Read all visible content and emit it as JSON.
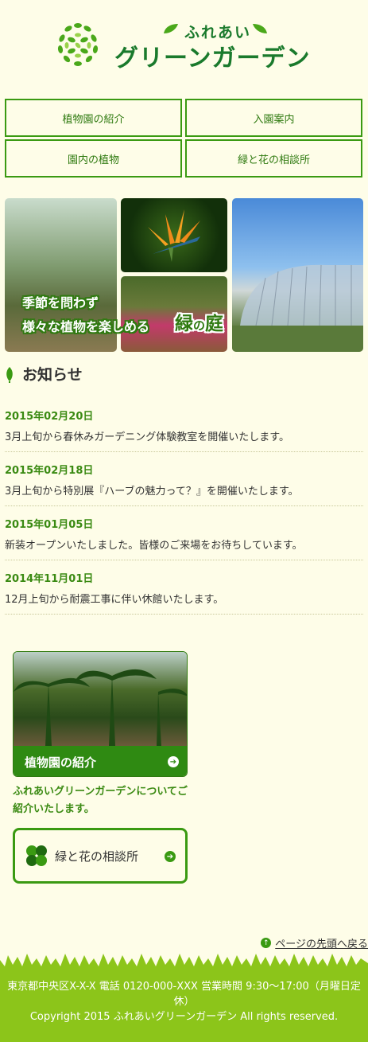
{
  "header": {
    "logo_sub": "ふれあい",
    "logo_main": "グリーンガーデン"
  },
  "nav": {
    "items": [
      {
        "label": "植物園の紹介"
      },
      {
        "label": "入園案内"
      },
      {
        "label": "園内の植物"
      },
      {
        "label": "緑と花の相談所"
      }
    ]
  },
  "hero": {
    "line1": "季節を問わず",
    "line2": "様々な植物を楽しめる",
    "big_a": "緑",
    "big_b": "の",
    "big_c": "庭"
  },
  "news": {
    "title": "お知らせ",
    "items": [
      {
        "date": "2015年02月20日",
        "text": "3月上旬から春休みガーデニング体験教室を開催いたします。"
      },
      {
        "date": "2015年02月18日",
        "text": "3月上旬から特別展『ハーブの魅力って？』を開催いたします。"
      },
      {
        "date": "2015年01月05日",
        "text": "新装オープンいたしました。皆様のご来場をお待ちしています。"
      },
      {
        "date": "2014年11月01日",
        "text": "12月上旬から耐震工事に伴い休館いたします。"
      }
    ]
  },
  "intro_card": {
    "label": "植物園の紹介",
    "desc": "ふれあいグリーンガーデンについてご紹介いたします。"
  },
  "consult": {
    "label": "緑と花の相談所"
  },
  "pagetop": {
    "label": "ページの先頭へ戻る"
  },
  "footer": {
    "address": "東京都中央区X-X-X 電話 0120-000-XXX 営業時間 9:30～17:00（月曜日定休）",
    "copyright": "Copyright 2015 ふれあいグリーンガーデン All rights reserved."
  },
  "colors": {
    "brand_green": "#2f7a10",
    "accent_green": "#3a9a12",
    "footer_green": "#8cc51a",
    "background": "#fefde8"
  }
}
